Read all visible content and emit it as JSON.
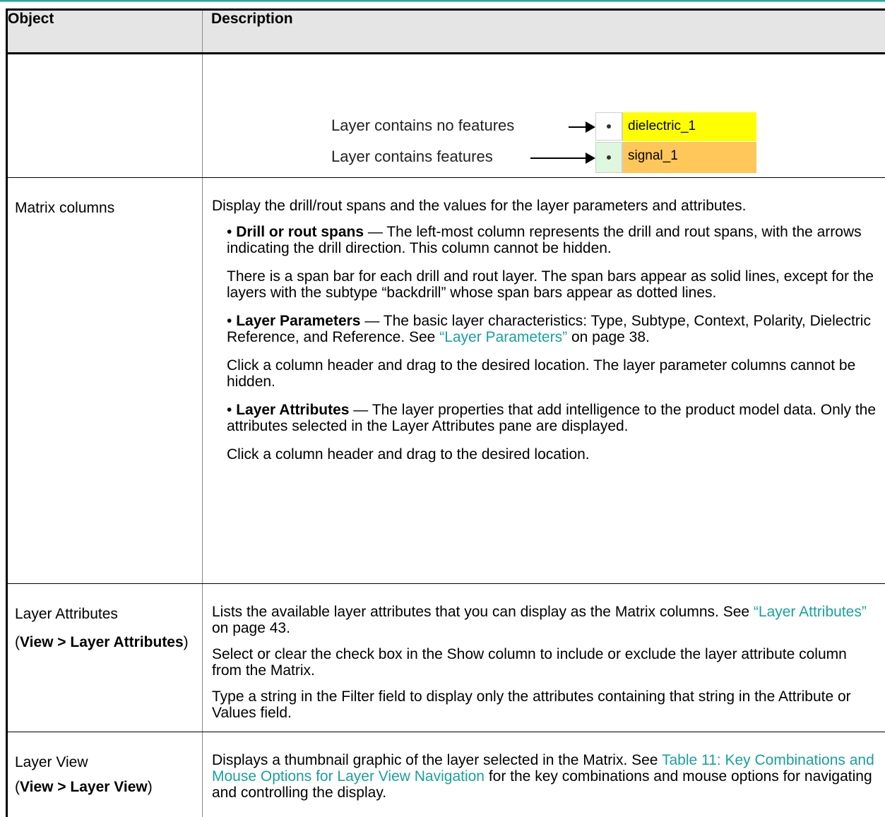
{
  "table": {
    "header": {
      "object": "Object",
      "description": "Description"
    }
  },
  "figure": {
    "label_no_features": "Layer contains no features",
    "label_features": "Layer contains features",
    "layer1": "dielectric_1",
    "layer2": "signal_1",
    "colors": {
      "dielectric": "#ffff00",
      "signal": "#ffc65a",
      "features_cell": "#dff7de"
    }
  },
  "rows": {
    "matrix": {
      "object": "Matrix columns",
      "intro": "Display the drill/rout spans and the values for the layer parameters and attributes.",
      "drill_title": "Drill or rout spans",
      "drill_text": "— The left-most column represents the drill and rout spans, with the arrows indicating the drill direction. This column cannot be hidden.",
      "drill_note": "There is a span bar for each drill and rout layer. The span bars appear as solid lines, except for the layers with the subtype “backdrill” whose span bars appear as dotted lines.",
      "params_title": "Layer Parameters",
      "params_text": "— The basic layer characteristics: Type, Subtype, Context, Polarity, Dielectric Reference, and Reference. See",
      "params_link": "“Layer Parameters”",
      "params_after": "on page 38.",
      "params_note": "Click a column header and drag to the desired location. The layer parameter columns cannot be hidden.",
      "attrs_title": "Layer Attributes",
      "attrs_text": "— The layer properties that add intelligence to the product model data. Only the attributes selected in the Layer Attributes pane are displayed.",
      "attrs_note": "Click a column header and drag to the desired location."
    },
    "attributes": {
      "object": "Layer Attributes",
      "object_sub": "View > Layer Attributes",
      "p1_before": "Lists the available layer attributes that you can display as the Matrix columns. See",
      "p1_link": "“Layer Attributes”",
      "p1_after": "on page 43.",
      "p2": "Select or clear the check box in the Show column to include or exclude the layer attribute column from the Matrix.",
      "p3": "Type a string in the Filter field to display only the attributes containing that string in the Attribute or Values field."
    },
    "view": {
      "object": "Layer View",
      "object_sub": "View > Layer View",
      "p1_before": "Displays a thumbnail graphic of the layer selected in the Matrix. See",
      "p1_link": "Table 11: Key Combinations and Mouse Options for Layer View Navigation",
      "p1_after": "for the key combinations and mouse options for navigating and controlling the display."
    }
  }
}
